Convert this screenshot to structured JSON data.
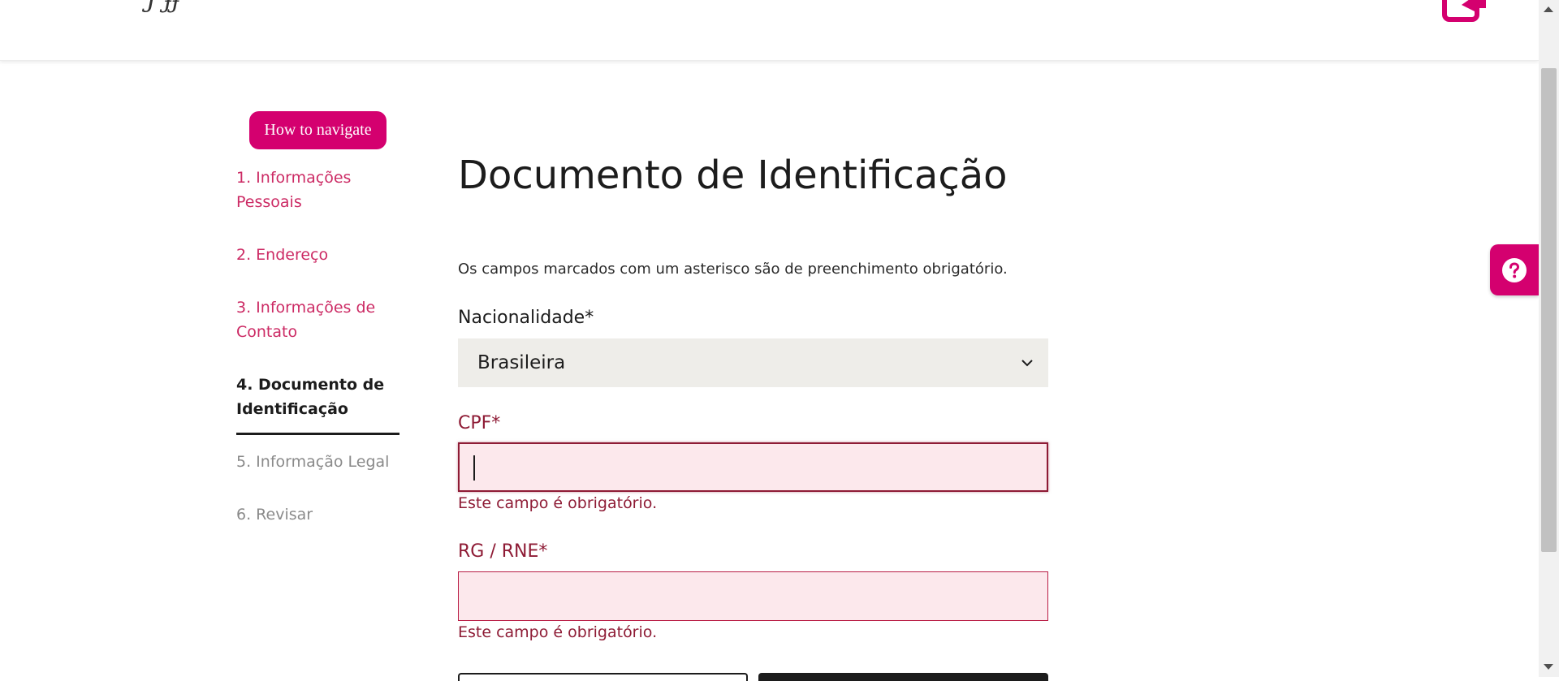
{
  "header": {
    "logo_fragment": "Ɉ ɟɉ",
    "edit_icon": "edit-icon"
  },
  "sidebar": {
    "help_button_label": "How to navigate",
    "steps": [
      {
        "label": "1. Informações Pessoais",
        "state": "done"
      },
      {
        "label": "2. Endereço",
        "state": "done"
      },
      {
        "label": "3. Informações de Contato",
        "state": "done"
      },
      {
        "label": "4. Documento de Identificação",
        "state": "current"
      },
      {
        "label": "5. Informação Legal",
        "state": "todo"
      },
      {
        "label": "6. Revisar",
        "state": "todo"
      }
    ]
  },
  "main": {
    "title": "Documento de Identificação",
    "required_note": "Os campos marcados com um asterisco são de preenchimento obrigatório.",
    "nationality": {
      "label": "Nacionalidade*",
      "selected": "Brasileira"
    },
    "cpf": {
      "label": "CPF*",
      "value": "",
      "error": "Este campo é obrigatório."
    },
    "rg": {
      "label": "RG / RNE*",
      "value": "",
      "error": "Este campo é obrigatório."
    }
  },
  "help_tab": {
    "icon": "question-icon"
  },
  "colors": {
    "accent": "#d4006f",
    "step_done": "#cc2a64",
    "error": "#8e1b35",
    "error_bg": "#fce8ec",
    "select_bg": "#eeede9"
  }
}
